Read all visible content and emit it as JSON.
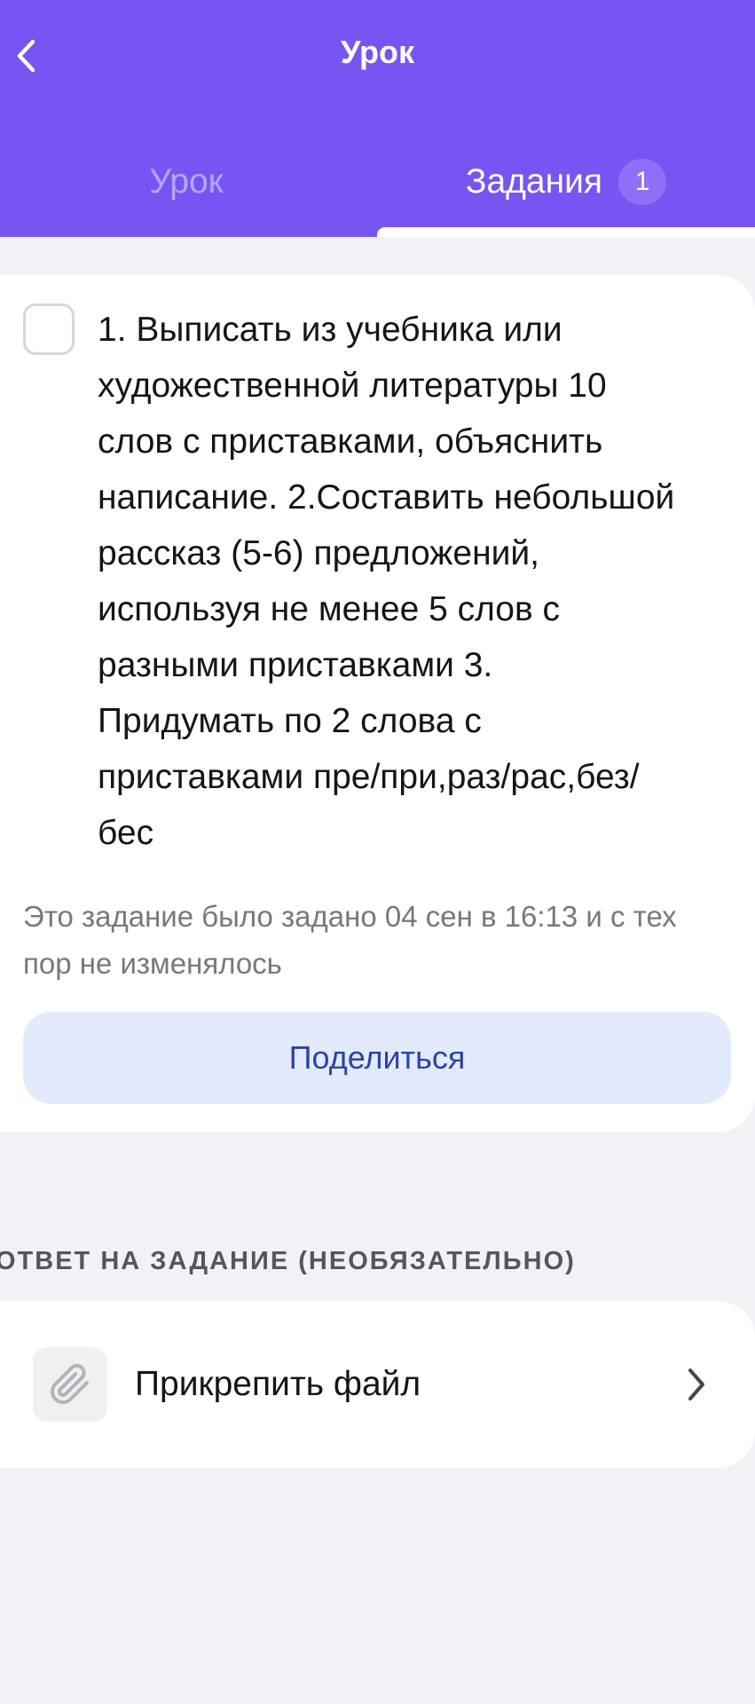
{
  "header": {
    "title": "Урок",
    "tabs": [
      {
        "label": "Урок",
        "active": false
      },
      {
        "label": "Задания",
        "active": true,
        "badge": "1"
      }
    ]
  },
  "task": {
    "completed": false,
    "text": "1. Выписать из учебника или\nхудожественной литературы 10\nслов с приставками, объяснить\nнаписание. 2.Составить небольшой\nрассказ (5-6) предложений,\nиспользуя не менее 5 слов с\nразными приставками 3.\nПридумать по 2 слова с\nприставками пре/при,раз/рас,без/\nбес",
    "assigned_note": "Это задание было задано 04 сен в 16:13 и с тех пор не изменялось",
    "share_label": "Поделиться"
  },
  "answer": {
    "section_label": "ОТВЕТ НА ЗАДАНИЕ (НЕОБЯЗАТЕЛЬНО)",
    "attach_label": "Прикрепить файл"
  },
  "icons": {
    "back": "chevron-left-icon",
    "attach": "paperclip-icon",
    "chevron": "chevron-right-icon"
  },
  "colors": {
    "header_bg": "#7755f2",
    "active_tab_text": "#ffffff",
    "inactive_tab_text": "#b4a6f9",
    "share_button_bg": "#e3eafb",
    "share_button_text": "#2b44a8"
  }
}
